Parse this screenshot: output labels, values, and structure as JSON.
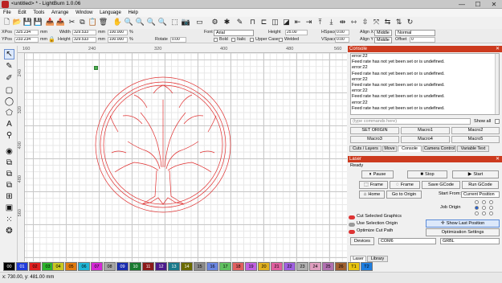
{
  "window": {
    "title": "<untitled> * - LightBurn 1.0.06",
    "minimize": "—",
    "maximize": "☐",
    "close": "✕"
  },
  "menu": [
    "File",
    "Edit",
    "Tools",
    "Arrange",
    "Window",
    "Language",
    "Help"
  ],
  "props": {
    "xpos_label": "XPos",
    "xpos_value": "325.234",
    "ypos_label": "YPos",
    "ypos_value": "233.234",
    "unit": "mm",
    "width_label": "Width",
    "width_value": "329.533",
    "height_label": "Height",
    "height_value": "329.533",
    "scale_w": "100.000",
    "scale_h": "100.000",
    "pct": "%",
    "rotate_label": "Rotate",
    "rotate_value": "0.00",
    "font_label": "Font",
    "font_value": "Arial",
    "height2_label": "Height",
    "height2_value": "25.00",
    "hspace_label": "HSpace",
    "hspace_value": "0.00",
    "vspace_label": "VSpace",
    "vspace_value": "0.00",
    "bold": "Bold",
    "italic": "Italic",
    "upper": "Upper Case",
    "welded": "Welded",
    "alignx_label": "Align X",
    "alignx_value": "Middle",
    "aligny_label": "Align Y",
    "aligny_value": "Middle",
    "offset_label": "Offset",
    "offset_value": "0",
    "mode1": "Normal",
    "mode2": ""
  },
  "ruler": {
    "h": [
      "160",
      "240",
      "320",
      "400",
      "480",
      "560"
    ],
    "v": [
      "240",
      "320",
      "400",
      "480",
      "560"
    ]
  },
  "palette": [
    {
      "label": "00",
      "color": "#000000",
      "fg": "#ffffff"
    },
    {
      "label": "01",
      "color": "#1f3bdb",
      "fg": "#ffffff"
    },
    {
      "label": "02",
      "color": "#e02020",
      "fg": "#000000"
    },
    {
      "label": "03",
      "color": "#2db52d",
      "fg": "#000000"
    },
    {
      "label": "04",
      "color": "#c8c820",
      "fg": "#000000"
    },
    {
      "label": "05",
      "color": "#e07a10",
      "fg": "#000000"
    },
    {
      "label": "06",
      "color": "#1fb5d6",
      "fg": "#000000"
    },
    {
      "label": "07",
      "color": "#d629d6",
      "fg": "#000000"
    },
    {
      "label": "08",
      "color": "#a5a5a5",
      "fg": "#000000"
    },
    {
      "label": "09",
      "color": "#1b2db0",
      "fg": "#ffffff"
    },
    {
      "label": "10",
      "color": "#1a7a30",
      "fg": "#ffffff"
    },
    {
      "label": "11",
      "color": "#8b1a1a",
      "fg": "#ffffff"
    },
    {
      "label": "12",
      "color": "#4a1a8b",
      "fg": "#ffffff"
    },
    {
      "label": "13",
      "color": "#1a7a8b",
      "fg": "#ffffff"
    },
    {
      "label": "14",
      "color": "#6b6b00",
      "fg": "#ffffff"
    },
    {
      "label": "15",
      "color": "#8a8a8a",
      "fg": "#000000"
    },
    {
      "label": "16",
      "color": "#6a85e0",
      "fg": "#000000"
    },
    {
      "label": "17",
      "color": "#60c060",
      "fg": "#000000"
    },
    {
      "label": "18",
      "color": "#e06060",
      "fg": "#000000"
    },
    {
      "label": "19",
      "color": "#c060e0",
      "fg": "#000000"
    },
    {
      "label": "20",
      "color": "#e0b020",
      "fg": "#000000"
    },
    {
      "label": "21",
      "color": "#e060a0",
      "fg": "#000000"
    },
    {
      "label": "22",
      "color": "#a060e0",
      "fg": "#000000"
    },
    {
      "label": "23",
      "color": "#b0b0b0",
      "fg": "#000000"
    },
    {
      "label": "24",
      "color": "#e0a0c0",
      "fg": "#000000"
    },
    {
      "label": "25",
      "color": "#b070b0",
      "fg": "#000000"
    },
    {
      "label": "26",
      "color": "#a06030",
      "fg": "#000000"
    },
    {
      "label": "27",
      "color": "#60a0e0",
      "fg": "#000000"
    },
    {
      "label": "28",
      "color": "#d0a060",
      "fg": "#000000"
    },
    {
      "label": "29",
      "color": "#c0c060",
      "fg": "#000000"
    },
    {
      "label": "T1",
      "color": "#e8c410",
      "fg": "#000000"
    },
    {
      "label": "T2",
      "color": "#1f7ee0",
      "fg": "#000000"
    }
  ],
  "status": "x: 730.00, y: 481.00 mm",
  "console": {
    "header": "Console",
    "lines": [
      "error:22",
      "Feed rate has not yet been set or is undefined.",
      "error:22",
      "Feed rate has not yet been set or is undefined.",
      "error:22",
      "Feed rate has not yet been set or is undefined.",
      "error:22",
      "Feed rate has not yet been set or is undefined.",
      "error:22",
      "Feed rate has not yet been set or is undefined."
    ],
    "input_placeholder": "(type commands here)",
    "show_all": "Show all",
    "macros": [
      "SET ORIGIN",
      "Macro1",
      "Macro2",
      "Macro3",
      "Macro4",
      "Macro5"
    ]
  },
  "tabs_top": [
    "Cuts / Layers",
    "Move",
    "Console",
    "Camera Control",
    "Variable Text"
  ],
  "laser": {
    "header": "Laser",
    "state": "Ready",
    "pause": "Pause",
    "stop": "Stop",
    "start": "Start",
    "frame1": "Frame",
    "frame2": "Frame",
    "save_gcode": "Save GCode",
    "run_gcode": "Run GCode",
    "home": "Home",
    "goto_origin": "Go to Origin",
    "start_from_label": "Start From:",
    "start_from_value": "Current Position",
    "job_origin": "Job Origin",
    "cut_selected": "Cut Selected Graphics",
    "use_sel_origin": "Use Selection Origin",
    "show_last": "Show Last Position",
    "optimize_path": "Optimize Cut Path",
    "opt_settings": "Optimization Settings",
    "devices": "Devices",
    "port": "COM6",
    "controller": "GRBL"
  },
  "tabs_bottom": [
    "Laser",
    "Library"
  ],
  "colors": {
    "accent": "#cc3a1e",
    "art": "#e03030"
  }
}
